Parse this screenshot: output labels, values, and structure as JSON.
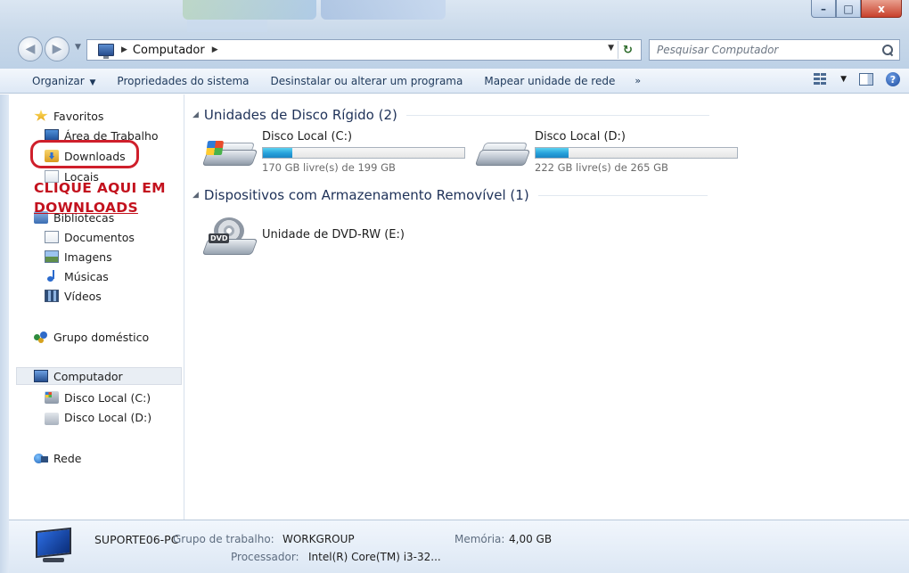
{
  "window": {
    "buttons": {
      "minimize": "–",
      "maximize": "□",
      "close": "x"
    }
  },
  "nav": {
    "back": "◀",
    "forward": "▶",
    "address_separator": "▶",
    "address_path": "Computador",
    "address_path_separator": "▶",
    "search_placeholder": "Pesquisar Computador",
    "refresh": "↻"
  },
  "toolbar": {
    "organize": "Organizar",
    "system_properties": "Propriedades do sistema",
    "uninstall": "Desinstalar ou alterar um programa",
    "map_drive": "Mapear unidade de rede",
    "more": "»",
    "help": "?"
  },
  "sidebar": {
    "favorites": "Favoritos",
    "desktop": "Área de Trabalho",
    "downloads": "Downloads",
    "places": "Locais",
    "libraries": "Bibliotecas",
    "documents": "Documentos",
    "images": "Imagens",
    "music": "Músicas",
    "videos": "Vídeos",
    "homegroup": "Grupo doméstico",
    "computer": "Computador",
    "drive_c": "Disco Local (C:)",
    "drive_d": "Disco Local (D:)",
    "network": "Rede"
  },
  "annotation": {
    "line1": "CLIQUE AQUI EM",
    "line2": "DOWNLOADS"
  },
  "content": {
    "hdd_group": "Unidades de Disco Rígido (2)",
    "removable_group": "Dispositivos com Armazenamento Removível (1)",
    "drives": [
      {
        "name": "Disco Local (C:)",
        "free": "170 GB livre(s) de 199 GB",
        "used_fraction": 0.146
      },
      {
        "name": "Disco Local (D:)",
        "free": "222 GB livre(s) de 265 GB",
        "used_fraction": 0.162
      }
    ],
    "dvd": {
      "name": "Unidade de DVD-RW (E:)",
      "badge": "DVD"
    }
  },
  "details": {
    "pc_name": "SUPORTE06-PC",
    "workgroup_label": "Grupo de trabalho:",
    "workgroup_value": "WORKGROUP",
    "memory_label": "Memória:",
    "memory_value": "4,00 GB",
    "processor_label": "Processador:",
    "processor_value": "Intel(R) Core(TM) i3-32..."
  }
}
